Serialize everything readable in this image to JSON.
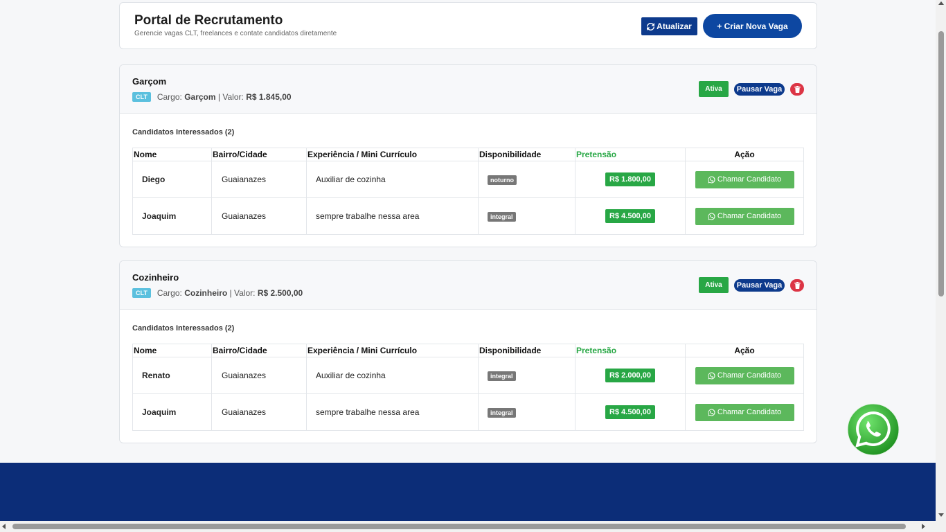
{
  "header": {
    "title": "Portal de Recrutamento",
    "subtitle": "Gerencie vagas CLT, freelances e contate candidatos diretamente",
    "refresh_label": "Atualizar",
    "create_label": "+ Criar Nova Vaga"
  },
  "labels": {
    "cargo": "Cargo:",
    "valor": "Valor:",
    "separator": "|"
  },
  "table_headers": {
    "nome": "Nome",
    "bairro": "Bairro/Cidade",
    "experiencia": "Experiência / Mini Currículo",
    "disponibilidade": "Disponibilidade",
    "pretensao": "Pretensão",
    "acao": "Ação"
  },
  "jobs": [
    {
      "title": "Garçom",
      "type": "CLT",
      "cargo": "Garçom",
      "valor": "R$ 1.845,00",
      "status": "Ativa",
      "pause_label": "Pausar Vaga",
      "candidates_title": "Candidatos Interessados (2)",
      "candidates": [
        {
          "nome": "Diego",
          "bairro": "Guaianazes",
          "experiencia": "Auxiliar de cozinha",
          "disponibilidade": "noturno",
          "pretensao": "R$ 1.800,00",
          "acao": "Chamar Candidato"
        },
        {
          "nome": "Joaquim",
          "bairro": "Guaianazes",
          "experiencia": "sempre trabalhe nessa area",
          "disponibilidade": "integral",
          "pretensao": "R$ 4.500,00",
          "acao": "Chamar Candidato"
        }
      ]
    },
    {
      "title": "Cozinheiro",
      "type": "CLT",
      "cargo": "Cozinheiro",
      "valor": "R$ 2.500,00",
      "status": "Ativa",
      "pause_label": "Pausar Vaga",
      "candidates_title": "Candidatos Interessados (2)",
      "candidates": [
        {
          "nome": "Renato",
          "bairro": "Guaianazes",
          "experiencia": "Auxiliar de cozinha",
          "disponibilidade": "integral",
          "pretensao": "R$ 2.000,00",
          "acao": "Chamar Candidato"
        },
        {
          "nome": "Joaquim",
          "bairro": "Guaianazes",
          "experiencia": "sempre trabalhe nessa area",
          "disponibilidade": "integral",
          "pretensao": "R$ 4.500,00",
          "acao": "Chamar Candidato"
        }
      ]
    }
  ],
  "colors": {
    "primary": "#0d47a1",
    "success": "#28a745",
    "danger": "#dc3545",
    "info": "#5bc0de",
    "whatsapp": "#5cb85c",
    "footer": "#0c2d78"
  },
  "icons": {
    "refresh": "refresh-icon",
    "delete": "trash-icon",
    "call": "whatsapp-icon",
    "fab": "whatsapp-icon"
  }
}
